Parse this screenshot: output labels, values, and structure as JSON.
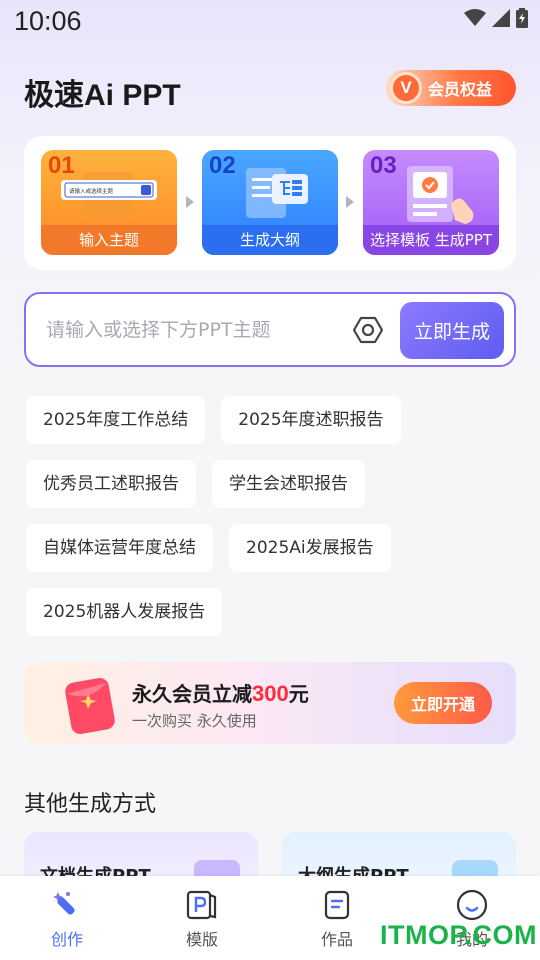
{
  "status_bar": {
    "time": "10:06"
  },
  "header": {
    "app_title": "极速Ai PPT",
    "vip_badge": "V",
    "vip_label": "会员权益"
  },
  "steps": [
    {
      "num": "01",
      "label": "输入主题",
      "preview_text": "请输入或选择主题"
    },
    {
      "num": "02",
      "label": "生成大纲"
    },
    {
      "num": "03",
      "label": "选择模板 生成PPT"
    }
  ],
  "input": {
    "placeholder": "请输入或选择下方PPT主题",
    "value": "",
    "generate_label": "立即生成"
  },
  "topic_chips": [
    [
      "2025年度工作总结",
      "2025年度述职报告"
    ],
    [
      "优秀员工述职报告",
      "学生会述职报告"
    ],
    [
      "自媒体运营年度总结",
      "2025Ai发展报告"
    ],
    [
      "2025机器人发展报告"
    ]
  ],
  "promo": {
    "title_prefix": "永久会员立减",
    "amount": "300",
    "unit": "元",
    "subtitle": "一次购买 永久使用",
    "button": "立即开通"
  },
  "other_methods": {
    "title": "其他生成方式",
    "cards": [
      {
        "label": "文档生成PPT"
      },
      {
        "label": "大纲生成PPT"
      }
    ]
  },
  "tab_bar": {
    "tabs": [
      {
        "label": "创作",
        "icon": "magic-wand-icon",
        "active": true
      },
      {
        "label": "模版",
        "icon": "template-icon",
        "active": false
      },
      {
        "label": "作品",
        "icon": "document-icon",
        "active": false
      },
      {
        "label": "我的",
        "icon": "smile-face-icon",
        "active": false
      }
    ]
  },
  "watermark": "ITMOP.COM",
  "colors": {
    "accent": "#5f5cf0",
    "active_tab": "#4c6ef5",
    "promo_red": "#ff2a3a",
    "watermark_green": "#19b34a"
  }
}
